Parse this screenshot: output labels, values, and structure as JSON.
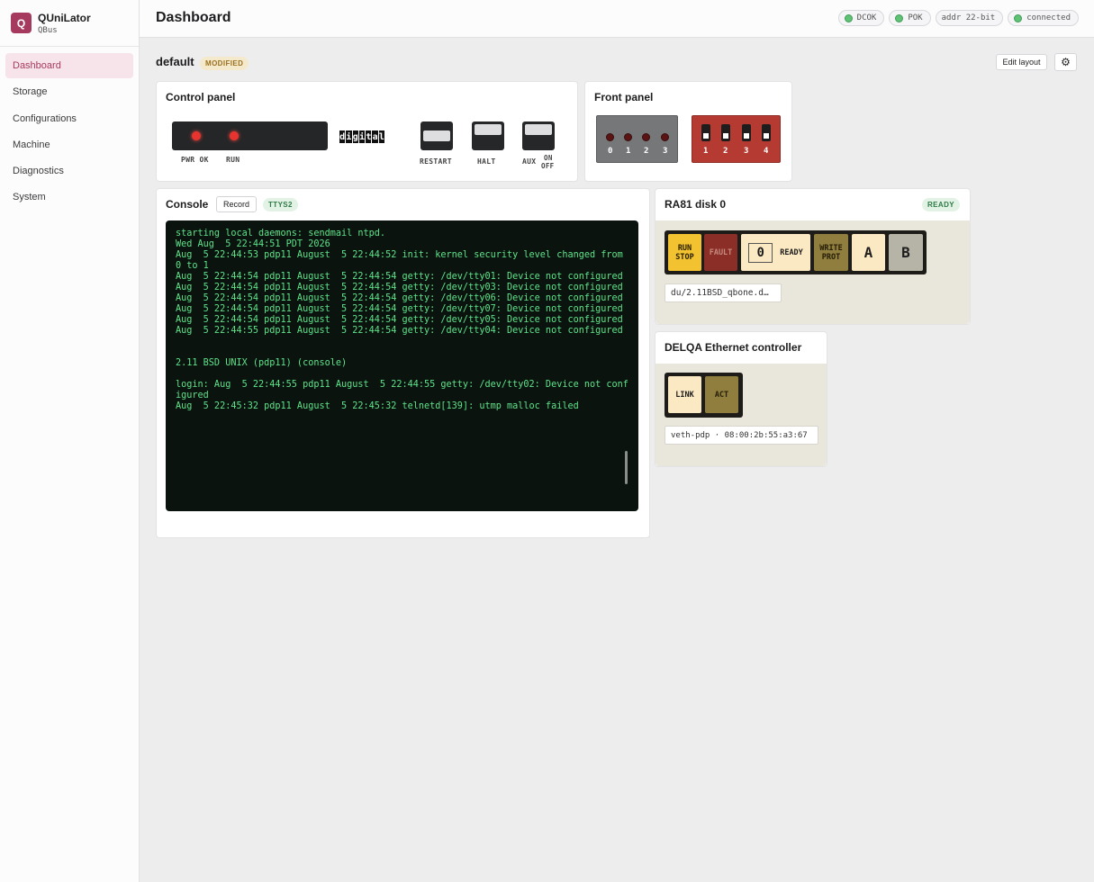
{
  "brand": {
    "logo_letter": "Q",
    "title": "QUniLator",
    "subtitle": "QBus"
  },
  "nav": [
    {
      "label": "Dashboard",
      "active": true
    },
    {
      "label": "Storage"
    },
    {
      "label": "Configurations"
    },
    {
      "label": "Machine"
    },
    {
      "label": "Diagnostics"
    },
    {
      "label": "System"
    }
  ],
  "header": {
    "title": "Dashboard",
    "chips": [
      {
        "label": "DCOK",
        "status_color": "#5fc275"
      },
      {
        "label": "POK",
        "status_color": "#5fc275"
      },
      {
        "label": "addr 22-bit"
      },
      {
        "label": "connected",
        "status_color": "#5fc275"
      }
    ]
  },
  "layout": {
    "name": "default",
    "status_badge": "MODIFIED",
    "edit_label": "Edit layout",
    "settings_icon": "gear-icon"
  },
  "control_panel": {
    "title": "Control panel",
    "lamps": [
      {
        "label": "PWR OK",
        "on": true
      },
      {
        "label": "RUN",
        "on": true
      }
    ],
    "logo_text": "digital",
    "switches": [
      {
        "label": "RESTART"
      },
      {
        "label": "HALT"
      },
      {
        "label": "AUX"
      }
    ],
    "aux_on": "ON",
    "aux_off": "OFF"
  },
  "front_panel": {
    "title": "Front panel",
    "leds": [
      "0",
      "1",
      "2",
      "3"
    ],
    "dips": [
      "1",
      "2",
      "3",
      "4"
    ]
  },
  "console": {
    "title": "Console",
    "record_label": "Record",
    "tty_badge": "TTYS2",
    "text": "starting local daemons: sendmail ntpd.\nWed Aug  5 22:44:51 PDT 2026\nAug  5 22:44:53 pdp11 August  5 22:44:52 init: kernel security level changed from 0 to 1\nAug  5 22:44:54 pdp11 August  5 22:44:54 getty: /dev/tty01: Device not configured\nAug  5 22:44:54 pdp11 August  5 22:44:54 getty: /dev/tty03: Device not configured\nAug  5 22:44:54 pdp11 August  5 22:44:54 getty: /dev/tty06: Device not configured\nAug  5 22:44:54 pdp11 August  5 22:44:54 getty: /dev/tty07: Device not configured\nAug  5 22:44:54 pdp11 August  5 22:44:54 getty: /dev/tty05: Device not configured\nAug  5 22:44:55 pdp11 August  5 22:44:54 getty: /dev/tty04: Device not configured\n\n\n2.11 BSD UNIX (pdp11) (console)\n\nlogin: Aug  5 22:44:55 pdp11 August  5 22:44:55 getty: /dev/tty02: Device not configured\nAug  5 22:45:32 pdp11 August  5 22:45:32 telnetd[139]: utmp malloc failed"
  },
  "ra81": {
    "title": "RA81 disk 0",
    "status": "READY",
    "run_stop_line1": "RUN",
    "run_stop_line2": "STOP",
    "fault": "FAULT",
    "unit": "0",
    "ready": "READY",
    "write_prot_line1": "WRITE",
    "write_prot_line2": "PROT",
    "port_a": "A",
    "port_b": "B",
    "image_path": "du/2.11BSD_qbone.d…"
  },
  "delqa": {
    "title": "DELQA Ethernet controller",
    "link": "LINK",
    "act": "ACT",
    "interface": "veth-pdp · 08:00:2b:55:a3:67"
  }
}
